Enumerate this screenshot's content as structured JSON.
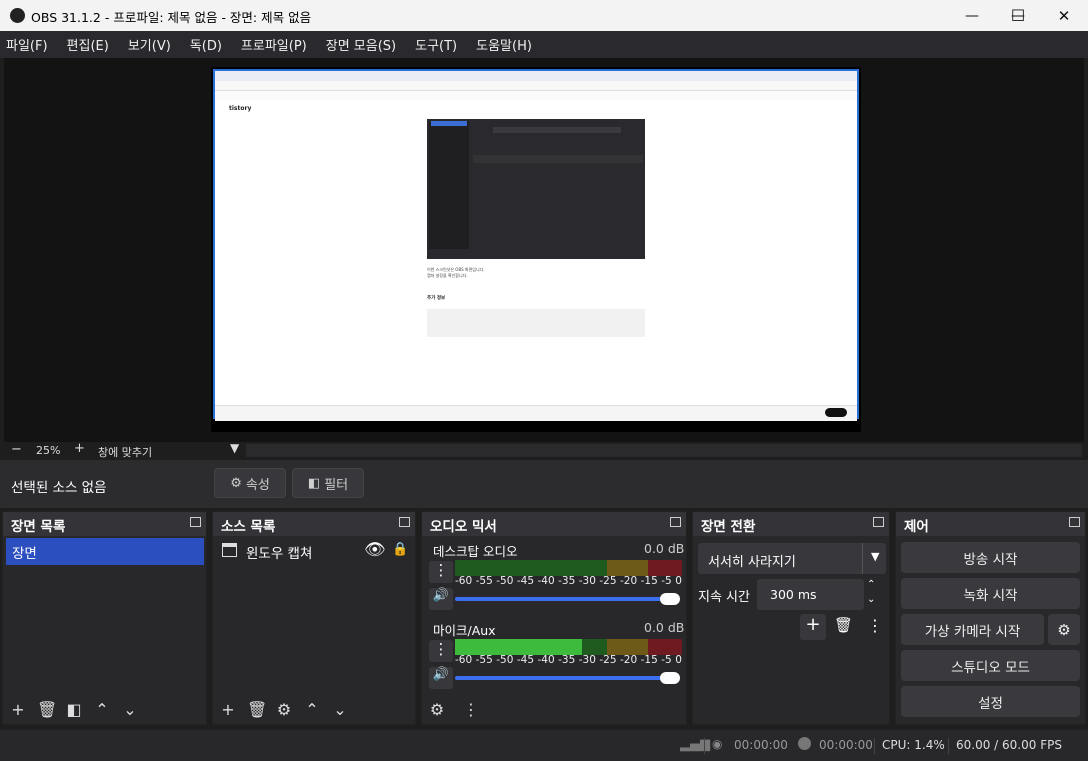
{
  "window": {
    "title": "OBS 31.1.2 - 프로파일: 제목 없음 - 장면: 제목 없음",
    "minimize": "—",
    "maximize": "☐",
    "close": "✕"
  },
  "menu": [
    "파일(F)",
    "편집(E)",
    "보기(V)",
    "독(D)",
    "프로파일(P)",
    "장면 모음(S)",
    "도구(T)",
    "도움말(H)"
  ],
  "zoom": {
    "minus": "−",
    "value": "25%",
    "plus": "+",
    "fit": "창에 맞추기"
  },
  "selection": {
    "label": "선택된 소스 없음",
    "properties": "속성",
    "filters": "필터"
  },
  "scenes": {
    "title": "장면 목록",
    "items": [
      "장면"
    ]
  },
  "sources": {
    "title": "소스 목록",
    "items": [
      {
        "name": "윈도우 캡쳐"
      }
    ]
  },
  "mixer": {
    "title": "오디오 믹서",
    "channels": [
      {
        "name": "데스크탑 오디오",
        "db": "0.0 dB",
        "level": 0
      },
      {
        "name": "마이크/Aux",
        "db": "0.0 dB",
        "level": 0.56
      }
    ],
    "ticks": [
      "-60",
      "-55",
      "-50",
      "-45",
      "-40",
      "-35",
      "-30",
      "-25",
      "-20",
      "-15",
      "-5",
      "0"
    ]
  },
  "transitions": {
    "title": "장면 전환",
    "selected": "서서히 사라지기",
    "duration_label": "지속 시간",
    "duration": "300 ms"
  },
  "controls": {
    "title": "제어",
    "stream": "방송 시작",
    "record": "녹화 시작",
    "vcam": "가상 카메라 시작",
    "studio": "스튜디오 모드",
    "settings": "설정"
  },
  "status": {
    "stream_time": "00:00:00",
    "record_time": "00:00:00",
    "cpu": "CPU: 1.4%",
    "fps": "60.00 / 60.00 FPS"
  },
  "preview": {
    "blog_title": "tistory",
    "text_lines": [
      "이번 스크린샷은 OBS 화면입니다.",
      "캡쳐 설정을 확인합니다."
    ],
    "section": "추가 정보"
  },
  "colors": {
    "accent": "#2c4fbf",
    "meter_green": "#3dbb3d",
    "meter_yellow": "#c8a22a",
    "meter_red": "#c2303a"
  }
}
